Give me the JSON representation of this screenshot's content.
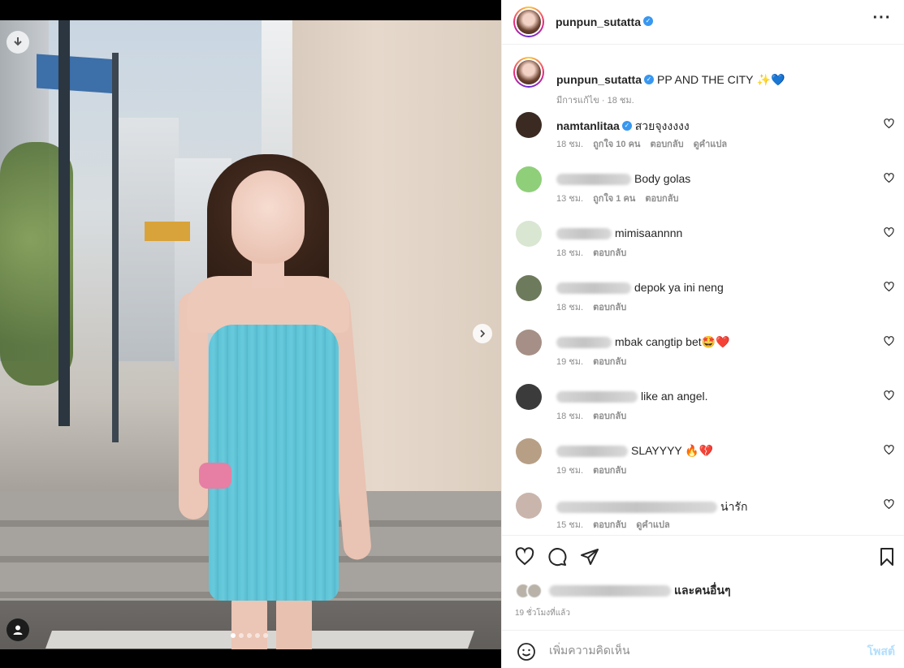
{
  "post": {
    "username": "punpun_sutatta",
    "caption": "PP AND THE CITY",
    "caption_emoji": "✨💙",
    "caption_meta": "มีการแก้ไข · 18 ชม.",
    "carousel_dots": 5,
    "active_dot": 0
  },
  "comments": [
    {
      "username": "namtanlitaa",
      "verified": true,
      "text": "สวยจุงงงงง",
      "time": "18 ชม.",
      "likes": "ถูกใจ 10 คน",
      "reply": "ตอบกลับ",
      "translate": "ดูคำแปล",
      "avatar_color": "#3a2a22"
    },
    {
      "username": "",
      "blur_width": 92,
      "text": "Body golas",
      "time": "13 ชม.",
      "likes": "ถูกใจ 1 คน",
      "reply": "ตอบกลับ",
      "translate": "",
      "avatar_color": "#8fcf7a"
    },
    {
      "username": "",
      "blur_width": 68,
      "text": "mimisaannnn",
      "time": "18 ชม.",
      "likes": "",
      "reply": "ตอบกลับ",
      "translate": "",
      "avatar_color": "#d9e6d2"
    },
    {
      "username": "",
      "blur_width": 92,
      "text": "depok ya ini neng",
      "time": "18 ชม.",
      "likes": "",
      "reply": "ตอบกลับ",
      "translate": "",
      "avatar_color": "#6e7a5c"
    },
    {
      "username": "",
      "blur_width": 68,
      "text": "mbak cangtip bet🤩❤️",
      "time": "19 ชม.",
      "likes": "",
      "reply": "ตอบกลับ",
      "translate": "",
      "avatar_color": "#a58f86"
    },
    {
      "username": "",
      "blur_width": 100,
      "text": "like an angel.",
      "time": "18 ชม.",
      "likes": "",
      "reply": "ตอบกลับ",
      "translate": "",
      "avatar_color": "#3b3b3b"
    },
    {
      "username": "",
      "blur_width": 88,
      "text": "SLAYYYY 🔥💔",
      "time": "19 ชม.",
      "likes": "",
      "reply": "ตอบกลับ",
      "translate": "",
      "avatar_color": "#b79f86"
    },
    {
      "username": "",
      "blur_width": 198,
      "text": "น่ารัก",
      "time": "15 ชม.",
      "likes": "",
      "reply": "ตอบกลับ",
      "translate": "ดูคำแปล",
      "avatar_color": "#c9b5ac"
    }
  ],
  "likes_row": {
    "suffix": "และคนอื่นๆ"
  },
  "post_time": "19 ชั่วโมงที่แล้ว",
  "add_comment": {
    "placeholder": "เพิ่มความคิดเห็น",
    "post_label": "โพสต์"
  },
  "colors": {
    "verified": "#3897f0",
    "post_button_disabled": "#b2dffc",
    "meta_gray": "#8e8e8e"
  },
  "icons": {
    "header_more": "more-horizontal-icon",
    "download": "download-arrow-icon",
    "next": "chevron-right-icon",
    "user_tag": "user-tag-icon",
    "like": "heart-outline-icon",
    "comment": "comment-bubble-icon",
    "share": "paper-plane-icon",
    "save": "bookmark-icon",
    "emoji": "smiley-icon"
  }
}
